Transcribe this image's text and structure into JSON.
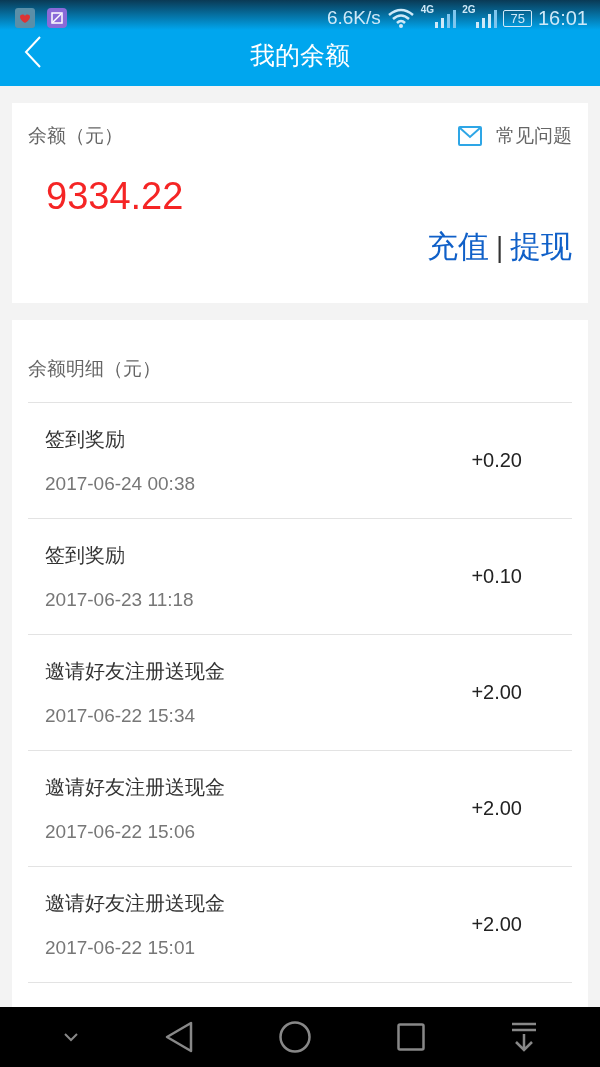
{
  "status_bar": {
    "speed": "6.6K/s",
    "network_1": "4G",
    "network_2": "2G",
    "battery": "75",
    "time": "16:01"
  },
  "header": {
    "title": "我的余额"
  },
  "balance": {
    "label": "余额（元）",
    "faq": "常见问题",
    "amount": "9334.22",
    "recharge": "充值",
    "separator": "|",
    "withdraw": "提现"
  },
  "details": {
    "title": "余额明细（元）",
    "rows": [
      {
        "name": "签到奖励",
        "time": "2017-06-24 00:38",
        "amount": "+0.20"
      },
      {
        "name": "签到奖励",
        "time": "2017-06-23 11:18",
        "amount": "+0.10"
      },
      {
        "name": "邀请好友注册送现金",
        "time": "2017-06-22 15:34",
        "amount": "+2.00"
      },
      {
        "name": "邀请好友注册送现金",
        "time": "2017-06-22 15:06",
        "amount": "+2.00"
      },
      {
        "name": "邀请好友注册送现金",
        "time": "2017-06-22 15:01",
        "amount": "+2.00"
      }
    ]
  }
}
